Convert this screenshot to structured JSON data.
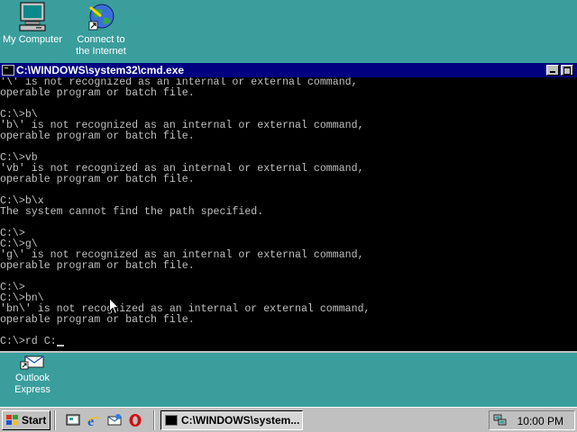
{
  "desktop": {
    "icons": [
      {
        "label": "My Computer"
      },
      {
        "label": "Connect to\nthe Internet"
      },
      {
        "label": "Outlook\nExpress"
      }
    ]
  },
  "window": {
    "title": "C:\\WINDOWS\\system32\\cmd.exe",
    "console_lines": [
      "'\\' is not recognized as an internal or external command,",
      "operable program or batch file.",
      "",
      "C:\\>b\\",
      "'b\\' is not recognized as an internal or external command,",
      "operable program or batch file.",
      "",
      "C:\\>vb",
      "'vb' is not recognized as an internal or external command,",
      "operable program or batch file.",
      "",
      "C:\\>b\\x",
      "The system cannot find the path specified.",
      "",
      "C:\\>",
      "C:\\>g\\",
      "'g\\' is not recognized as an internal or external command,",
      "operable program or batch file.",
      "",
      "C:\\>",
      "C:\\>bn\\",
      "'bn\\' is not recognized as an internal or external command,",
      "operable program or batch file.",
      ""
    ],
    "prompt_line": "C:\\>rd C:"
  },
  "taskbar": {
    "start_label": "Start",
    "task_label": "C:\\WINDOWS\\system...",
    "clock": "10:00 PM"
  },
  "colors": {
    "desktop": "#3a9e9d",
    "titlebar": "#000080",
    "console_bg": "#000000",
    "console_fg": "#c0c0c0"
  }
}
